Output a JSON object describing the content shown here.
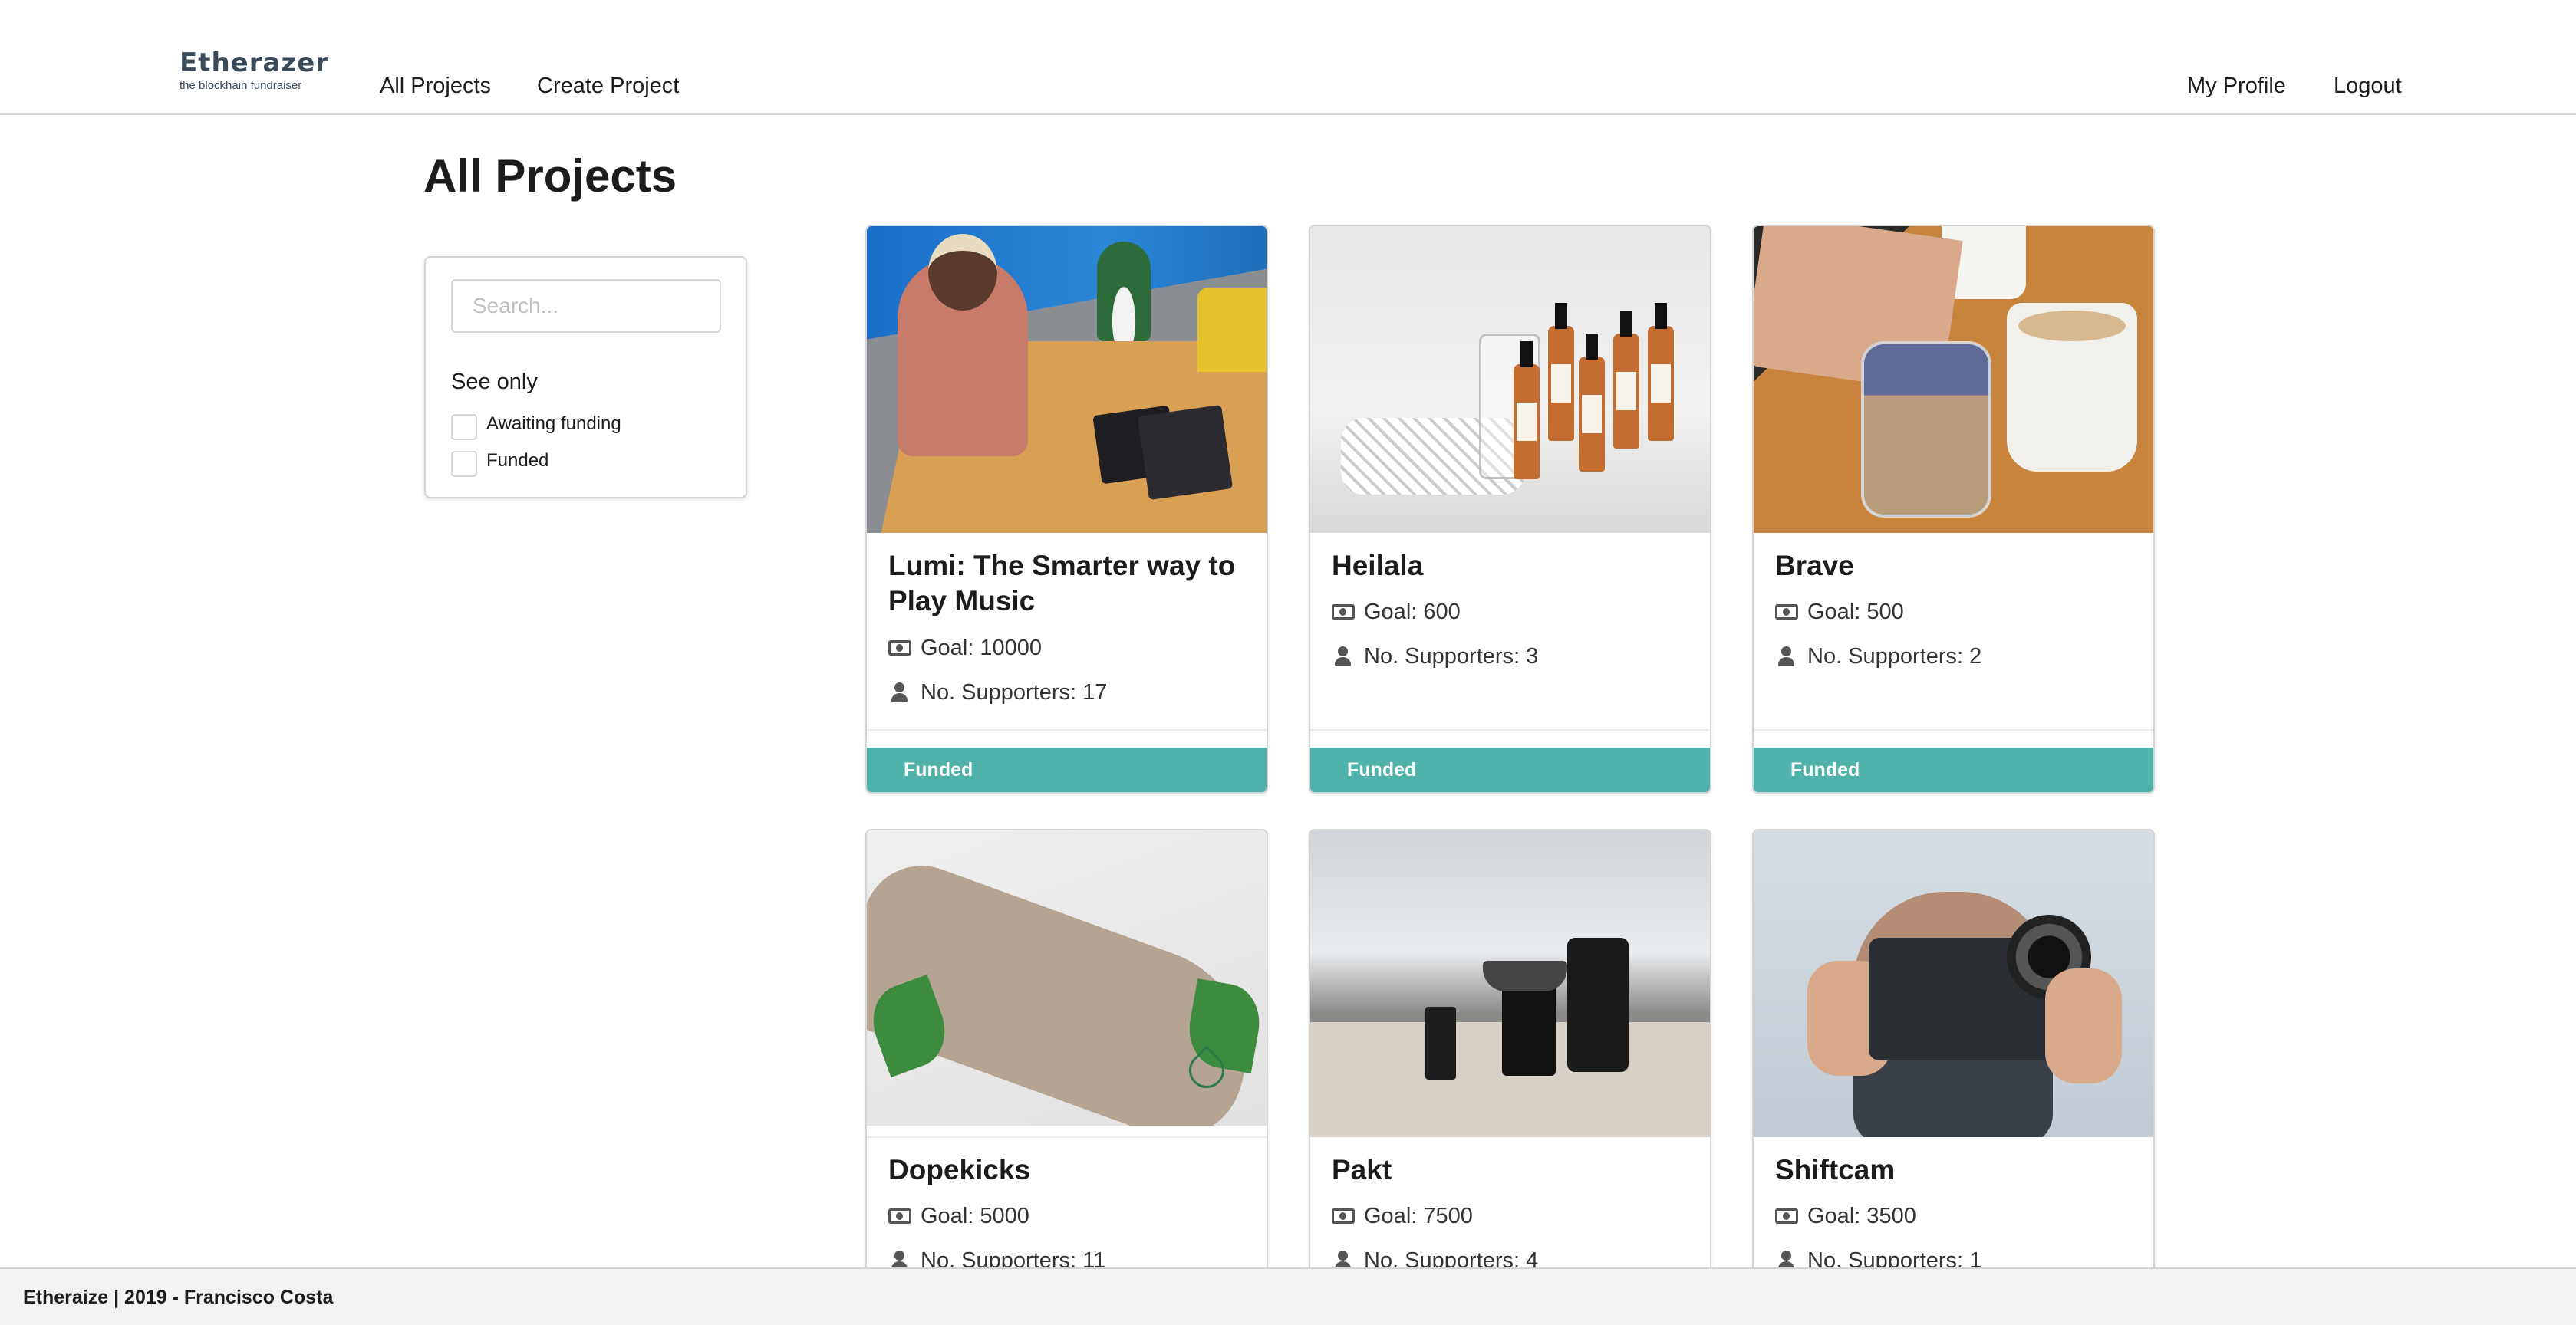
{
  "app": {
    "logo_text": "Etherazer",
    "logo_tagline": "the blockhain fundraiser"
  },
  "nav": {
    "all_projects": "All Projects",
    "create_project": "Create Project",
    "my_profile": "My Profile",
    "logout": "Logout"
  },
  "page": {
    "title": "All Projects"
  },
  "filter": {
    "search_placeholder": "Search...",
    "see_only": "See only",
    "options": [
      {
        "label": "Awaiting funding",
        "checked": false
      },
      {
        "label": "Funded",
        "checked": false
      }
    ]
  },
  "projects": [
    {
      "title": "Lumi: The Smarter way to Play Music",
      "goal": "Goal: 10000",
      "supporters": "No. Supporters: 17",
      "status": "Funded",
      "image": "person-playing-keyboard"
    },
    {
      "title": "Heilala",
      "goal": "Goal: 600",
      "supporters": "No. Supporters: 3",
      "status": "Funded",
      "image": "vanilla-bottles"
    },
    {
      "title": "Brave",
      "goal": "Goal: 500",
      "supporters": "No. Supporters: 2",
      "status": "Funded",
      "image": "jar-and-coffee"
    },
    {
      "title": "Dopekicks",
      "goal": "Goal: 5000",
      "supporters": "No. Supporters: 11",
      "status": "",
      "image": "hemp-sneaker"
    },
    {
      "title": "Pakt",
      "goal": "Goal: 7500",
      "supporters": "No. Supporters: 4",
      "status": "",
      "image": "coffee-kit"
    },
    {
      "title": "Shiftcam",
      "goal": "Goal: 3500",
      "supporters": "No. Supporters: 1",
      "status": "",
      "image": "phone-camera-lens"
    }
  ],
  "colors": {
    "funded_bar": "#4fb3ab",
    "logo": "#3b4a59",
    "border": "#d4d4d5"
  },
  "icons": {
    "goal": "money-bill-icon",
    "supporters": "user-icon"
  },
  "footer": {
    "text": "Etheraize | 2019 - Francisco Costa"
  }
}
